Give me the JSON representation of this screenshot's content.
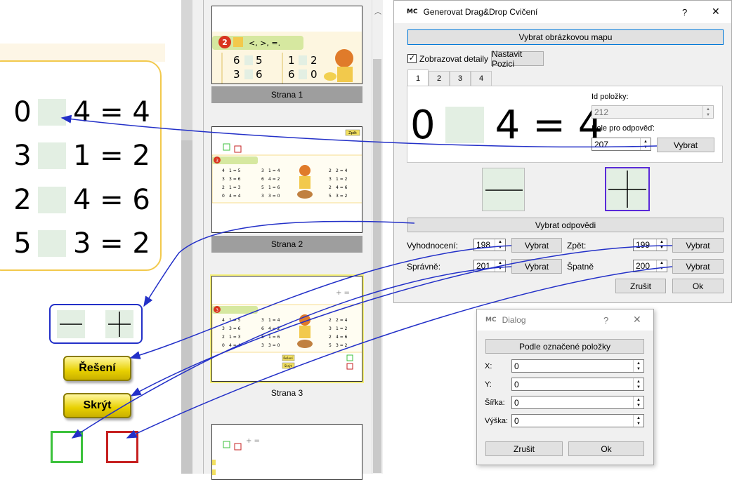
{
  "worksheet": {
    "equations": [
      {
        "a": "0",
        "rest": "4 = 4"
      },
      {
        "a": "3",
        "rest": "1 = 2"
      },
      {
        "a": "2",
        "rest": "4 = 6"
      },
      {
        "a": "5",
        "rest": "3 = 2"
      }
    ],
    "solution_button": "Řešení",
    "hide_button": "Skrýt"
  },
  "thumbnails": {
    "pages": [
      {
        "caption": "Strana 1"
      },
      {
        "caption": "Strana 2"
      },
      {
        "caption": "Strana 3"
      }
    ],
    "page1": {
      "badge": "2",
      "symbols": "<, >, =.",
      "rows": [
        [
          "6",
          "5",
          "1",
          "2"
        ],
        [
          "3",
          "6",
          "6",
          "0"
        ]
      ]
    },
    "page2": {
      "badge": "3",
      "tag": "Zpět",
      "rows": [
        [
          "4",
          "1 = 5",
          "3",
          "1 = 4",
          "2",
          "2 = 4"
        ],
        [
          "3",
          "3 = 6",
          "6",
          "4 = 2",
          "3",
          "1 = 2"
        ],
        [
          "2",
          "1 = 3",
          "5",
          "1 = 6",
          "2",
          "4 = 6"
        ],
        [
          "0",
          "4 = 4",
          "3",
          "3 = 0",
          "5",
          "3 = 2"
        ]
      ]
    },
    "page3": {
      "badge": "3",
      "btn1": "Řešení",
      "btn2": "Skrýt"
    }
  },
  "dialog": {
    "logo": "MC",
    "title": "Generovat Drag&Drop Cvičení",
    "help": "?",
    "close": "✕",
    "select_image_map": "Vybrat obrázkovou mapu",
    "show_details_label": "Zobrazovat detaily",
    "show_details_checked": true,
    "set_position": "Nastavit Pozici",
    "tabs": [
      "1",
      "2",
      "3",
      "4"
    ],
    "preview": {
      "a": "0",
      "rest": "4 = 4"
    },
    "item_id_label": "Id položky:",
    "item_id_value": "212",
    "answer_field_label": "Pole pro odpověď:",
    "answer_field_value": "207",
    "select": "Vybrat",
    "select_answers": "Vybrat odpovědi",
    "evaluation_label": "Vyhodnocení:",
    "evaluation_value": "198",
    "back_label": "Zpět:",
    "back_value": "199",
    "correct_label": "Správně:",
    "correct_value": "201",
    "wrong_label": "Špatně",
    "wrong_value": "200",
    "cancel": "Zrušit",
    "ok": "Ok"
  },
  "dialog2": {
    "logo": "MC",
    "title": "Dialog",
    "help": "?",
    "close": "✕",
    "by_selected": "Podle označené položky",
    "fields": [
      {
        "label": "X:",
        "value": "0"
      },
      {
        "label": "Y:",
        "value": "0"
      },
      {
        "label": "Šířka:",
        "value": "0"
      },
      {
        "label": "Výška:",
        "value": "0"
      }
    ],
    "cancel": "Zrušit",
    "ok": "Ok"
  },
  "colors": {
    "arrow": "#2330c8",
    "highlight": "#f5f07a",
    "selected_tile": "#5a2ad8"
  }
}
